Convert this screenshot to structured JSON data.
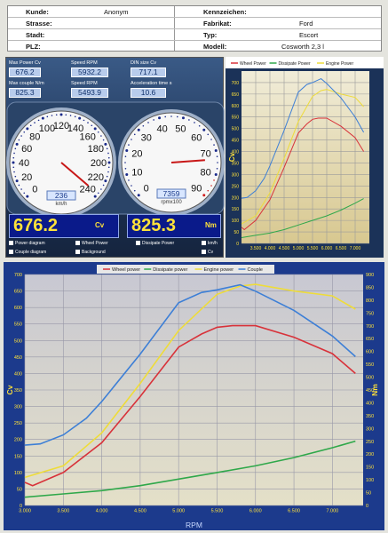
{
  "header": {
    "kunde_label": "Kunde:",
    "kunde_value": "Anonym",
    "strasse_label": "Strasse:",
    "stadt_label": "Stadt:",
    "plz_label": "PLZ:",
    "kennzeichen_label": "Kennzeichen:",
    "fabrikat_label": "Fabrikat:",
    "fabrikat_value": "Ford",
    "typ_label": "Typ:",
    "typ_value": "Escort",
    "modell_label": "Modell:",
    "modell_value": "Cosworth 2,3 l"
  },
  "dash": {
    "max_power_label": "Max Power Cv",
    "max_power_value": "676.2",
    "speed_rpm_label": "Speed RPM",
    "speed_rpm_value": "5932.2",
    "din_size_label": "DIN size Cv",
    "din_size_value": "717.1",
    "max_couple_label": "Max couple N/m",
    "max_couple_value": "825.3",
    "speed_rpm2_label": "Speed RPM",
    "speed_rpm2_value": "5493.9",
    "accel_label": "Acceleration time s",
    "accel_value": "10.6",
    "speedo_value": "236",
    "speedo_unit": "km/h",
    "speedo_ticks": [
      "0",
      "20",
      "40",
      "60",
      "80",
      "100",
      "120",
      "140",
      "160",
      "180",
      "200",
      "220",
      "240"
    ],
    "tacho_value": "7359",
    "tacho_unit": "rpmx100",
    "tacho_ticks": [
      "0",
      "10",
      "20",
      "30",
      "40",
      "50",
      "60",
      "70",
      "80",
      "90"
    ],
    "power_big": "676.2",
    "power_unit": "Cv",
    "torque_big": "825.3",
    "torque_unit": "Nm",
    "checks": {
      "power_diagram": "Power diagram",
      "couple_diagram": "Couple diagram",
      "wheel_power": "Wheel Power",
      "background": "Background",
      "dissipate_power": "Dissipate Power",
      "km_h": "km/h",
      "cv": "Cv"
    }
  },
  "colors": {
    "wheel": "#d8323a",
    "dissipate": "#2fa84a",
    "engine": "#eedc3a",
    "couple": "#3d7fd6"
  },
  "chart_data": [
    {
      "type": "line",
      "legend": [
        "Wheel Power",
        "Dissipate Power",
        "Engine Power"
      ],
      "legend_placement": "top",
      "grid": true,
      "y_ticks_left": [
        "0",
        "50",
        "100",
        "150",
        "200",
        "250",
        "300",
        "350",
        "400",
        "450",
        "500",
        "550",
        "600",
        "650",
        "700"
      ],
      "x_ticks": [
        "3.500",
        "4.000",
        "4.500",
        "5.000",
        "5.500",
        "6.000",
        "6.500",
        "7.000"
      ],
      "ylabel": "Cv",
      "xlim": [
        3000,
        7500
      ],
      "ylim": [
        0,
        750
      ]
    },
    {
      "type": "line",
      "legend": [
        "Wheel power",
        "Dissipate power",
        "Engine power",
        "Couple"
      ],
      "legend_placement": "top",
      "grid": true,
      "xlabel": "RPM",
      "ylabel": "Cv",
      "ylabel_right": "Nm",
      "xlim": [
        3000,
        7400
      ],
      "ylim": [
        0,
        700
      ],
      "ylim_right": [
        0,
        900
      ],
      "x_ticks": [
        "3.000",
        "3.500",
        "4.000",
        "4.500",
        "5.000",
        "5.500",
        "6.000",
        "6.500",
        "7.000"
      ],
      "y_ticks_left": [
        "0",
        "50",
        "100",
        "150",
        "200",
        "250",
        "300",
        "350",
        "400",
        "450",
        "500",
        "550",
        "600",
        "650",
        "700"
      ],
      "y_ticks_right": [
        "0",
        "50",
        "100",
        "150",
        "200",
        "250",
        "300",
        "350",
        "400",
        "450",
        "500",
        "550",
        "600",
        "650",
        "700",
        "750",
        "800",
        "850",
        "900"
      ],
      "series": [
        {
          "name": "Wheel power",
          "axis": "left",
          "x": [
            3000,
            3100,
            3500,
            4000,
            4500,
            5000,
            5300,
            5500,
            5700,
            6000,
            6500,
            7000,
            7300
          ],
          "y": [
            70,
            60,
            100,
            190,
            330,
            480,
            520,
            540,
            545,
            545,
            510,
            460,
            400
          ]
        },
        {
          "name": "Dissipate power",
          "axis": "left",
          "x": [
            3000,
            3500,
            4000,
            4500,
            5000,
            5500,
            6000,
            6500,
            7000,
            7300
          ],
          "y": [
            25,
            35,
            45,
            60,
            80,
            100,
            120,
            145,
            175,
            195
          ]
        },
        {
          "name": "Engine power",
          "axis": "left",
          "x": [
            3000,
            3500,
            4000,
            4500,
            5000,
            5500,
            5800,
            6000,
            6500,
            7000,
            7300
          ],
          "y": [
            85,
            120,
            220,
            370,
            530,
            640,
            665,
            670,
            650,
            635,
            595
          ]
        },
        {
          "name": "Couple",
          "axis": "right",
          "x": [
            3000,
            3200,
            3500,
            3800,
            4000,
            4500,
            5000,
            5300,
            5500,
            5800,
            6000,
            6500,
            7000,
            7300
          ],
          "y": [
            235,
            240,
            275,
            340,
            405,
            590,
            790,
            830,
            840,
            860,
            835,
            760,
            660,
            580
          ]
        }
      ]
    }
  ]
}
